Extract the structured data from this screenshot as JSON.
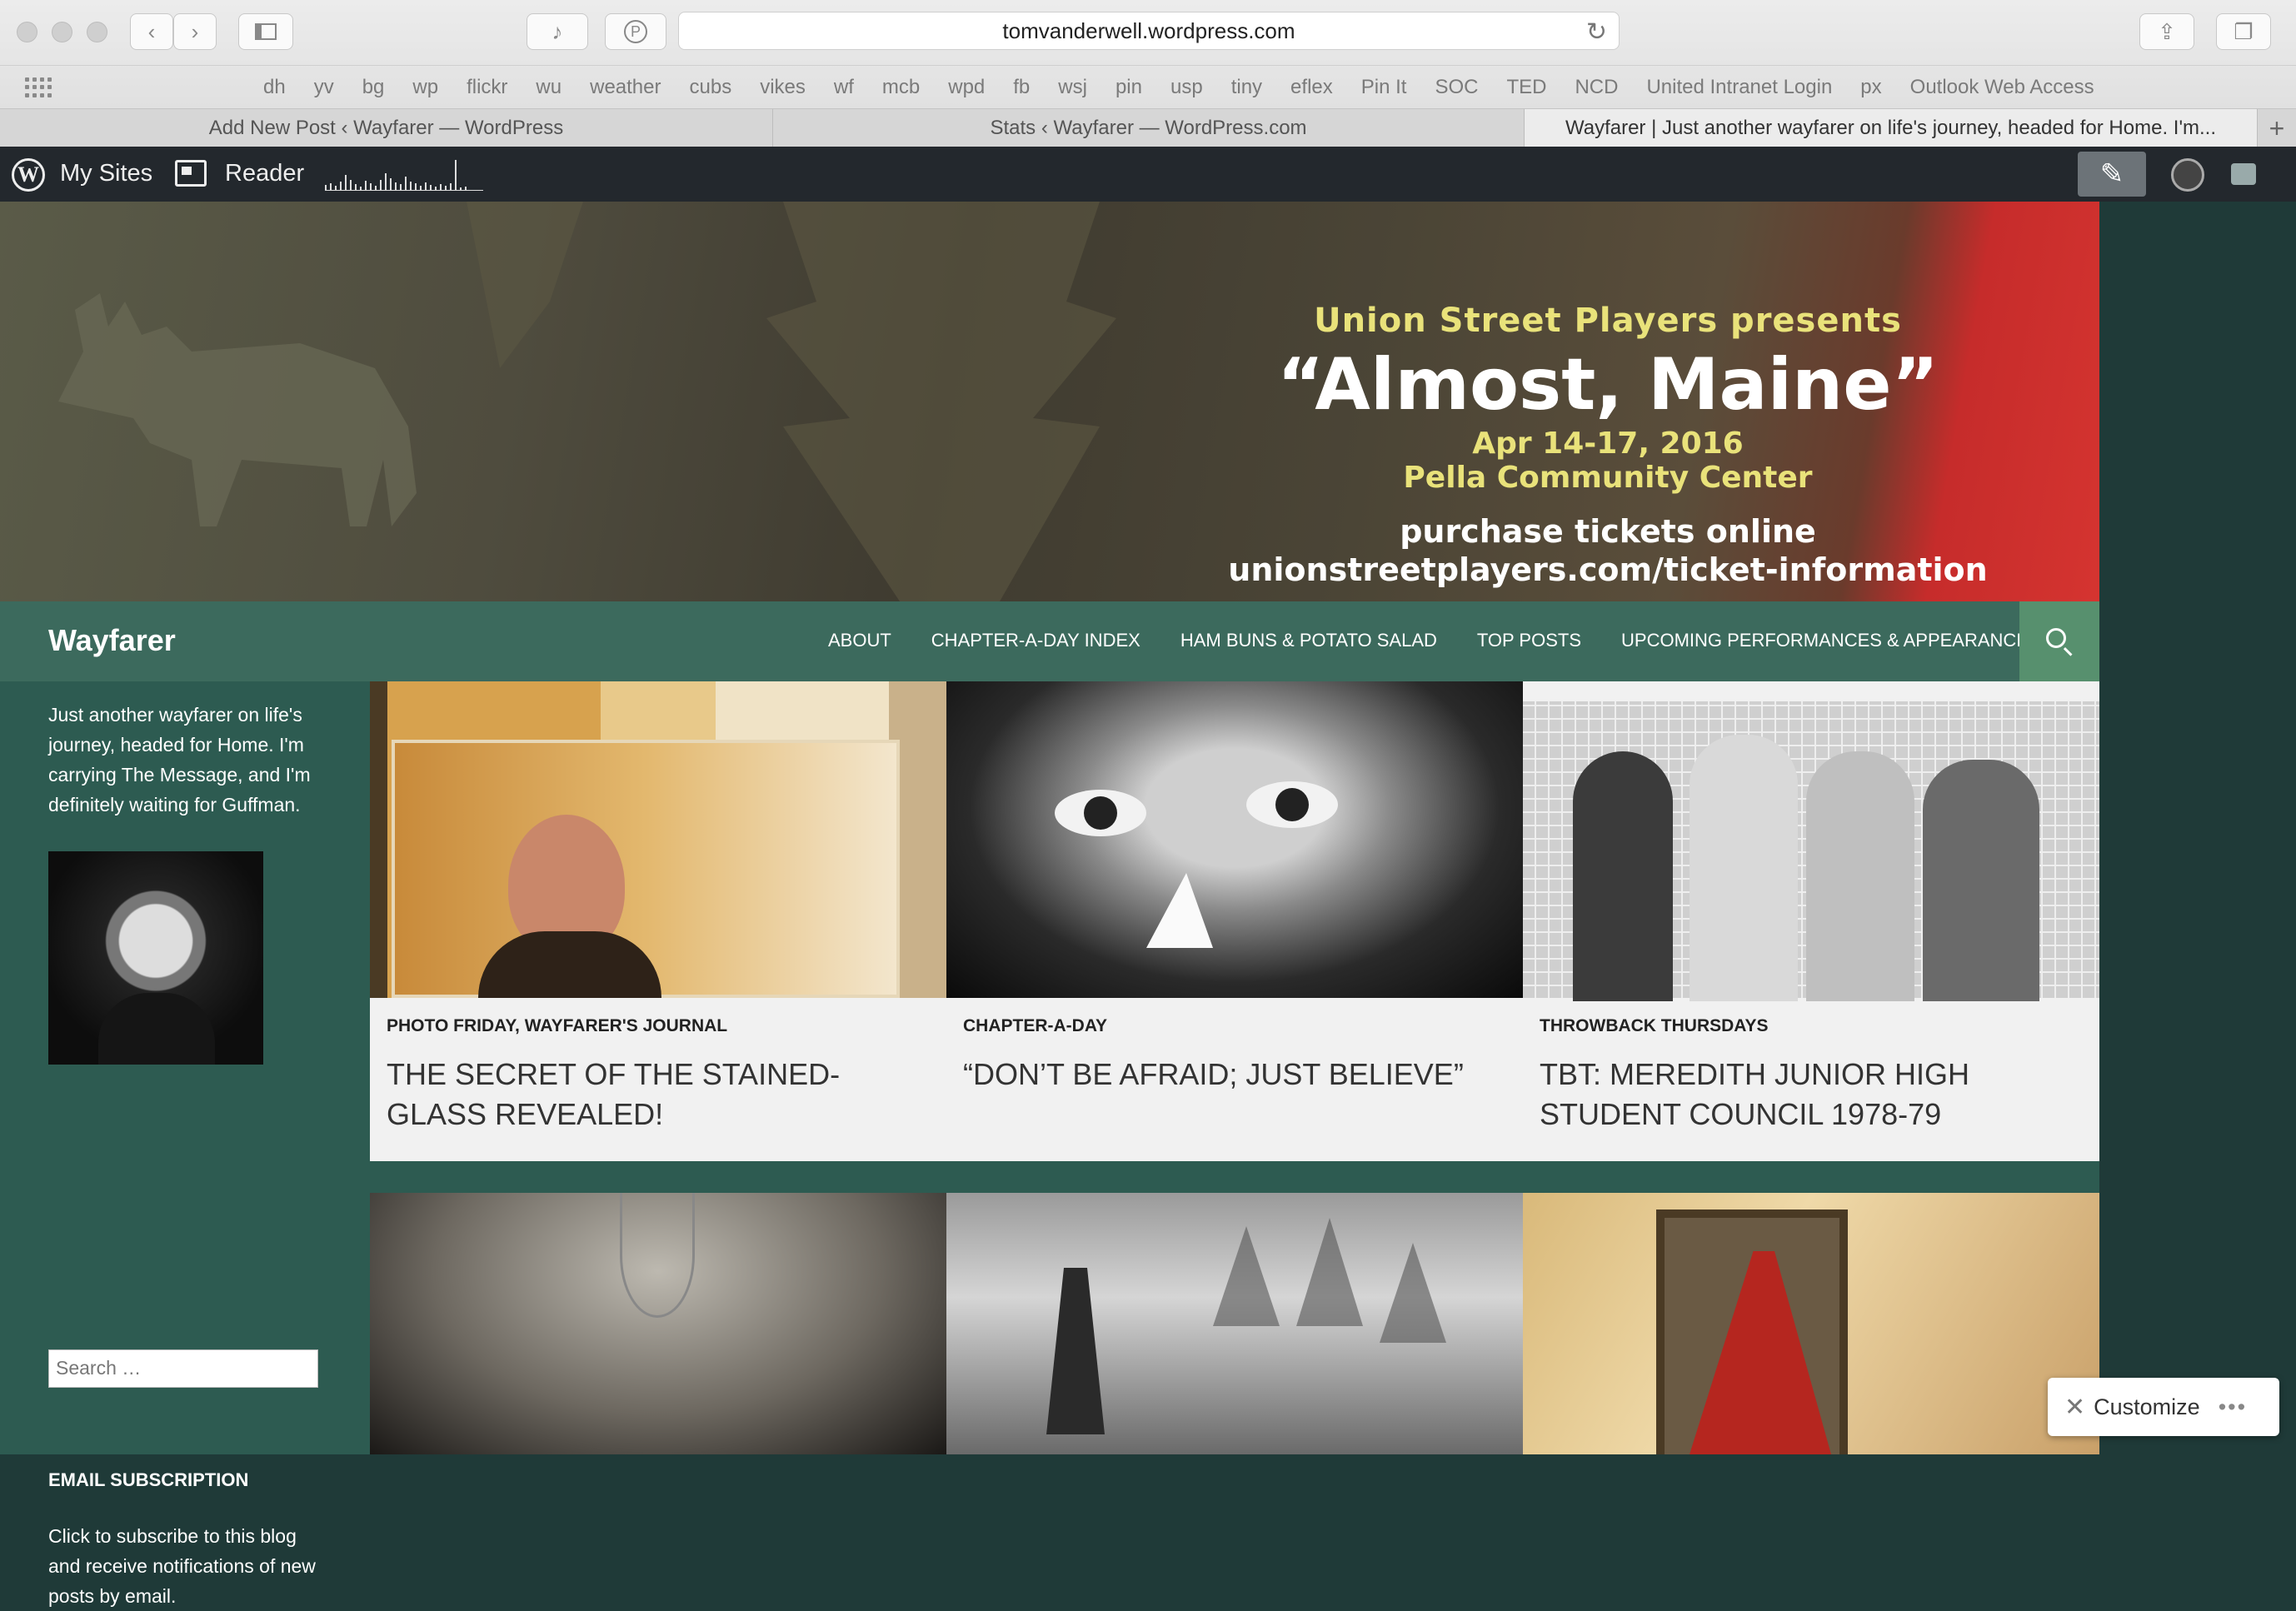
{
  "browser": {
    "url": "tomvanderwell.wordpress.com",
    "favorites": [
      "dh",
      "yv",
      "bg",
      "wp",
      "flickr",
      "wu",
      "weather",
      "cubs",
      "vikes",
      "wf",
      "mcb",
      "wpd",
      "fb",
      "wsj",
      "pin",
      "usp",
      "tiny",
      "eflex",
      "Pin It",
      "SOC",
      "TED",
      "NCD",
      "United Intranet Login",
      "px",
      "Outlook Web Access"
    ],
    "tabs": [
      {
        "label": "Add New Post ‹ Wayfarer — WordPress",
        "active": false
      },
      {
        "label": "Stats ‹ Wayfarer — WordPress.com",
        "active": false
      },
      {
        "label": "Wayfarer | Just another wayfarer on life's journey, headed for Home. I'm...",
        "active": true
      }
    ]
  },
  "adminbar": {
    "my_sites": "My Sites",
    "reader": "Reader"
  },
  "header": {
    "line1": "Union Street Players presents",
    "line2": "“Almost, Maine”",
    "line3": "Apr 14-17, 2016",
    "line4": "Pella Community Center",
    "line5": "purchase tickets online",
    "line6": "unionstreetplayers.com/ticket-information"
  },
  "site": {
    "title": "Wayfarer",
    "nav": [
      "ABOUT",
      "CHAPTER-A-DAY INDEX",
      "HAM BUNS & POTATO SALAD",
      "TOP POSTS",
      "UPCOMING PERFORMANCES & APPEARANCES"
    ]
  },
  "sidebar": {
    "tagline": "Just another wayfarer on life's journey, headed for Home. I'm carrying The Message, and I'm definitely waiting for Guffman.",
    "search_placeholder": "Search …",
    "email_heading": "EMAIL SUBSCRIPTION",
    "email_text": "Click to subscribe to this blog and receive notifications of new posts by email."
  },
  "posts": [
    {
      "category": "PHOTO FRIDAY, WAYFARER'S JOURNAL",
      "title": "THE SECRET OF THE STAINED-GLASS REVEALED!"
    },
    {
      "category": "CHAPTER-A-DAY",
      "title": "“DON’T BE AFRAID; JUST BELIEVE”"
    },
    {
      "category": "THROWBACK THURSDAYS",
      "title": "TBT: MEREDITH JUNIOR HIGH STUDENT COUNCIL 1978-79"
    }
  ],
  "customize": {
    "label": "Customize"
  }
}
